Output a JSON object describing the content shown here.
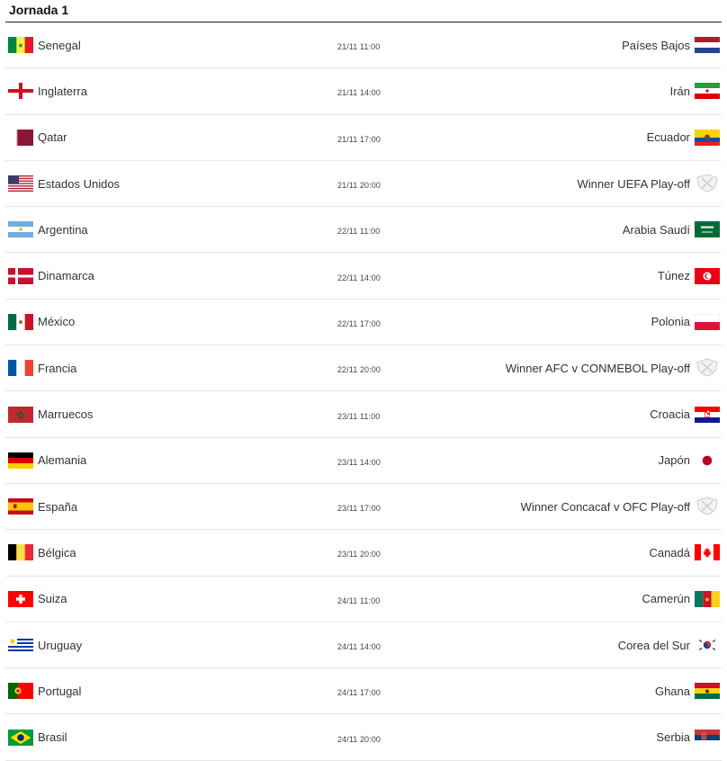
{
  "title": "Jornada 1",
  "matches": [
    {
      "home": "Senegal",
      "home_flag": "senegal-flag",
      "time": "21/11 11:00",
      "away": "Países Bajos",
      "away_flag": "netherlands-flag"
    },
    {
      "home": "Inglaterra",
      "home_flag": "england-flag",
      "time": "21/11 14:00",
      "away": "Irán",
      "away_flag": "iran-flag"
    },
    {
      "home": "Qatar",
      "home_flag": "qatar-flag",
      "time": "21/11 17:00",
      "away": "Ecuador",
      "away_flag": "ecuador-flag"
    },
    {
      "home": "Estados Unidos",
      "home_flag": "usa-flag",
      "time": "21/11 20:00",
      "away": "Winner UEFA Play-off",
      "away_flag": "placeholder-shield-icon"
    },
    {
      "home": "Argentina",
      "home_flag": "argentina-flag",
      "time": "22/11 11:00",
      "away": "Arabia Saudí",
      "away_flag": "saudi-arabia-flag"
    },
    {
      "home": "Dinamarca",
      "home_flag": "denmark-flag",
      "time": "22/11 14:00",
      "away": "Túnez",
      "away_flag": "tunisia-flag"
    },
    {
      "home": "México",
      "home_flag": "mexico-flag",
      "time": "22/11 17:00",
      "away": "Polonia",
      "away_flag": "poland-flag"
    },
    {
      "home": "Francia",
      "home_flag": "france-flag",
      "time": "22/11 20:00",
      "away": "Winner AFC v CONMEBOL Play-off",
      "away_flag": "placeholder-shield-icon"
    },
    {
      "home": "Marruecos",
      "home_flag": "morocco-flag",
      "time": "23/11 11:00",
      "away": "Croacia",
      "away_flag": "croatia-flag"
    },
    {
      "home": "Alemania",
      "home_flag": "germany-flag",
      "time": "23/11 14:00",
      "away": "Japón",
      "away_flag": "japan-flag"
    },
    {
      "home": "España",
      "home_flag": "spain-flag",
      "time": "23/11 17:00",
      "away": "Winner Concacaf v OFC Play-off",
      "away_flag": "placeholder-shield-icon"
    },
    {
      "home": "Bélgica",
      "home_flag": "belgium-flag",
      "time": "23/11 20:00",
      "away": "Canadá",
      "away_flag": "canada-flag"
    },
    {
      "home": "Suiza",
      "home_flag": "switzerland-flag",
      "time": "24/11 11:00",
      "away": "Camerún",
      "away_flag": "cameroon-flag"
    },
    {
      "home": "Uruguay",
      "home_flag": "uruguay-flag",
      "time": "24/11 14:00",
      "away": "Corea del Sur",
      "away_flag": "south-korea-flag"
    },
    {
      "home": "Portugal",
      "home_flag": "portugal-flag",
      "time": "24/11 17:00",
      "away": "Ghana",
      "away_flag": "ghana-flag"
    },
    {
      "home": "Brasil",
      "home_flag": "brazil-flag",
      "time": "24/11 20:00",
      "away": "Serbia",
      "away_flag": "serbia-flag"
    }
  ]
}
